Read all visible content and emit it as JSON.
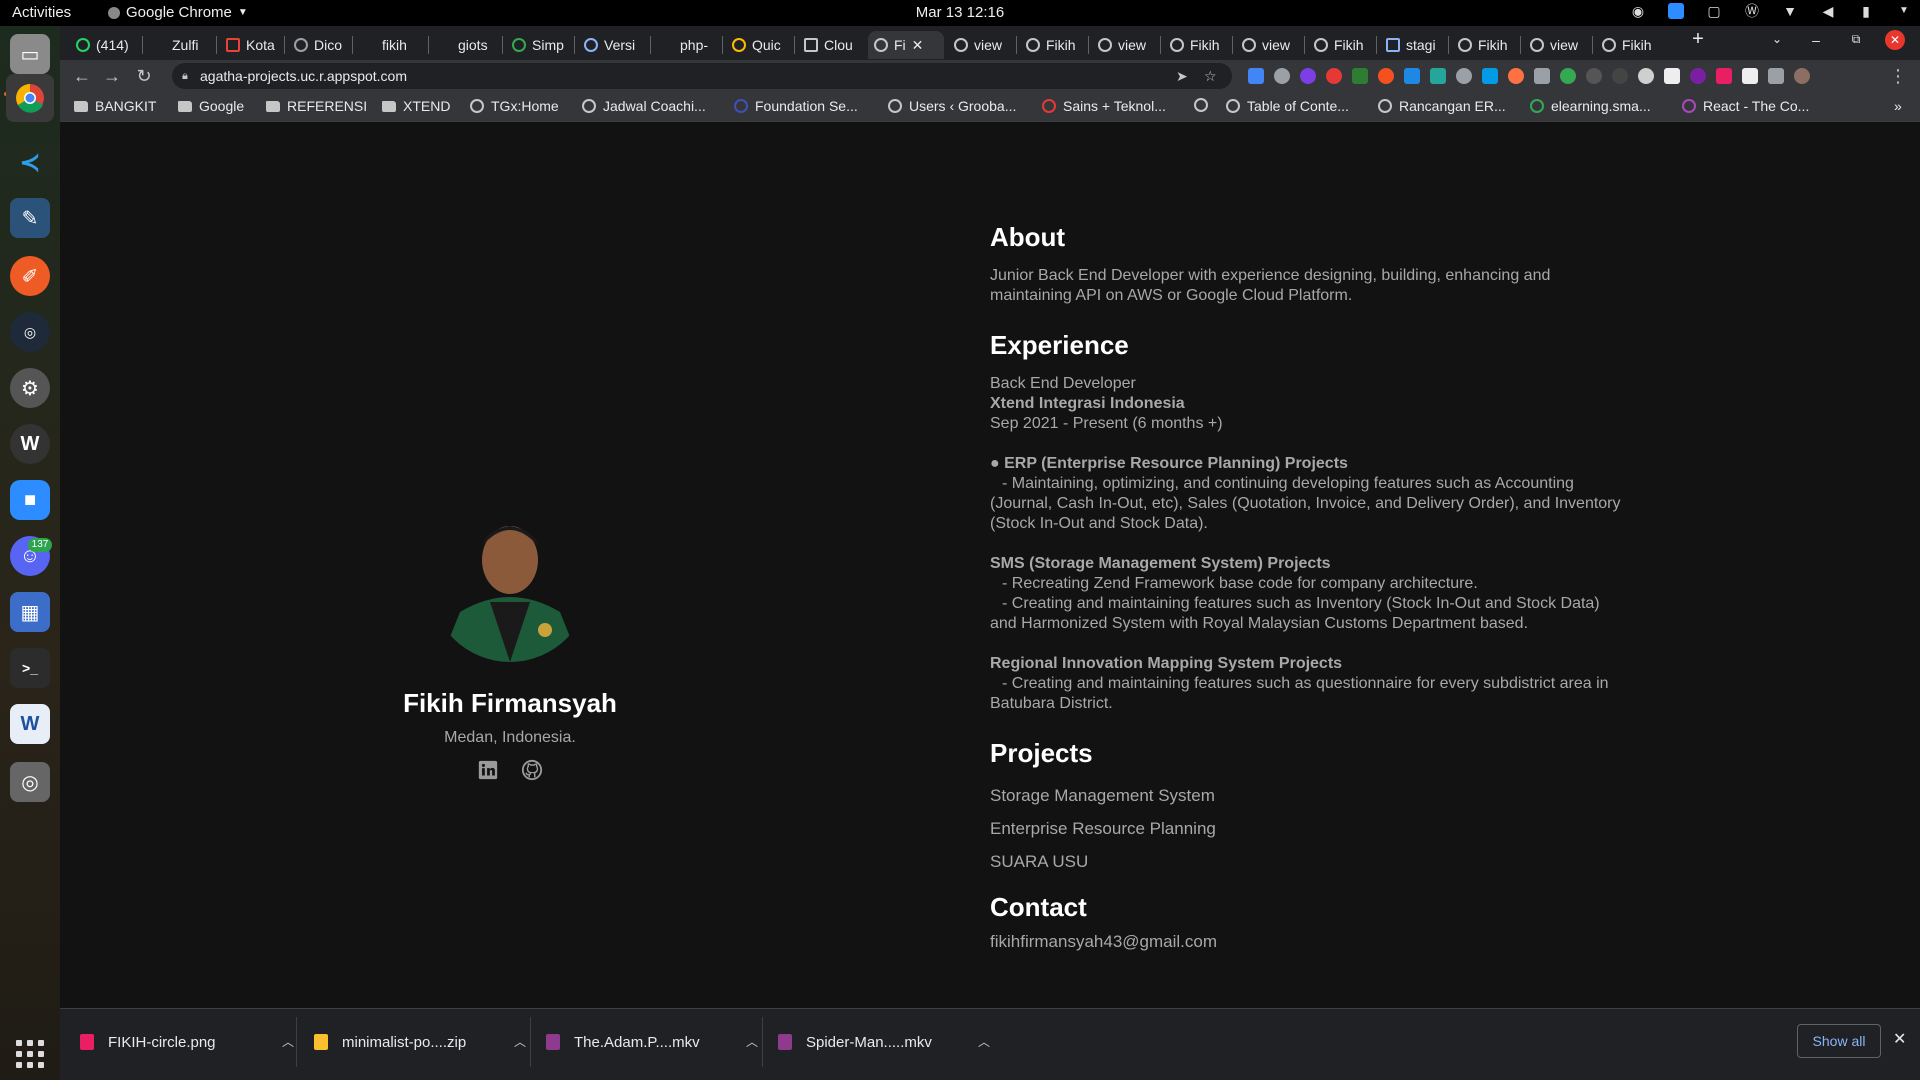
{
  "system": {
    "activities": "Activities",
    "app_name": "Google Chrome",
    "clock": "Mar 13  12:16"
  },
  "tabs": [
    {
      "label": "(414)"
    },
    {
      "label": "Zulfi"
    },
    {
      "label": "Kota"
    },
    {
      "label": "Dico"
    },
    {
      "label": "fikih"
    },
    {
      "label": "giots"
    },
    {
      "label": "Simp"
    },
    {
      "label": "Versi"
    },
    {
      "label": "php-"
    },
    {
      "label": "Quic"
    },
    {
      "label": "Clou"
    },
    {
      "label": "Fi"
    },
    {
      "label": "view"
    },
    {
      "label": "Fikih"
    },
    {
      "label": "view"
    },
    {
      "label": "Fikih"
    },
    {
      "label": "view"
    },
    {
      "label": "Fikih"
    },
    {
      "label": "stagi"
    },
    {
      "label": "Fikih"
    },
    {
      "label": "view"
    },
    {
      "label": "Fikih"
    }
  ],
  "address_bar": {
    "url": "agatha-projects.uc.r.appspot.com"
  },
  "bookmarks": [
    {
      "label": "BANGKIT"
    },
    {
      "label": "Google"
    },
    {
      "label": "REFERENSI"
    },
    {
      "label": "XTEND"
    },
    {
      "label": "TGx:Home"
    },
    {
      "label": "Jadwal Coachi..."
    },
    {
      "label": "Foundation Se..."
    },
    {
      "label": "Users ‹ Grooba..."
    },
    {
      "label": "Sains + Teknol..."
    },
    {
      "label": ""
    },
    {
      "label": "Table of Conte..."
    },
    {
      "label": "Rancangan ER..."
    },
    {
      "label": "elearning.sma..."
    },
    {
      "label": "React - The Co..."
    }
  ],
  "profile": {
    "name": "Fikih Firmansyah",
    "location": "Medan, Indonesia."
  },
  "about": {
    "heading": "About",
    "text": "Junior Back End Developer with experience designing, building, enhancing and maintaining API on AWS or Google Cloud Platform."
  },
  "experience": {
    "heading": "Experience",
    "role": "Back End Developer",
    "company": "Xtend Integrasi Indonesia",
    "dates": "Sep 2021 - Present (6 months +)",
    "projects": [
      {
        "title": "● ERP (Enterprise Resource Planning) Projects",
        "lines": [
          "- Maintaining, optimizing, and continuing developing features such as Accounting (Journal, Cash In-Out, etc), Sales (Quotation, Invoice, and Delivery Order), and Inventory (Stock In-Out and Stock Data)."
        ]
      },
      {
        "title": "SMS (Storage Management System) Projects",
        "lines": [
          "- Recreating Zend Framework base code for company architecture.",
          "- Creating and maintaining features such as Inventory (Stock In-Out and Stock Data) and Harmonized System with Royal Malaysian Customs Department based."
        ]
      },
      {
        "title": "Regional Innovation Mapping System Projects",
        "lines": [
          "- Creating and maintaining features such as questionnaire for every subdistrict area in Batubara District."
        ]
      }
    ]
  },
  "projects": {
    "heading": "Projects",
    "items": [
      "Storage Management System",
      "Enterprise Resource Planning",
      "SUARA USU"
    ]
  },
  "contact": {
    "heading": "Contact",
    "email": "fikihfirmansyah43@gmail.com"
  },
  "downloads": [
    {
      "label": "FIKIH-circle.png"
    },
    {
      "label": "minimalist-po....zip"
    },
    {
      "label": "The.Adam.P....mkv"
    },
    {
      "label": "Spider-Man.....mkv"
    }
  ],
  "downloads_bar": {
    "show_all": "Show all"
  },
  "dock": {
    "discord_badge": "137"
  },
  "colors": {
    "page_bg": "#121212",
    "link_blue": "#8ab4f8",
    "close_red": "#e8372c"
  }
}
